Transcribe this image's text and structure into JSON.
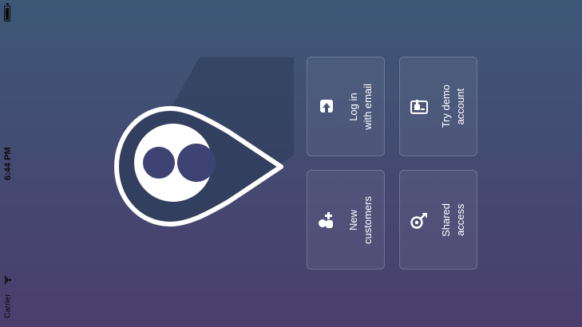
{
  "status_bar": {
    "time": "6:44 PM",
    "carrier": "Carrier",
    "battery_icon": "battery-icon",
    "wifi_icon": "wifi-icon"
  },
  "theme": {
    "gradient_top": "#3d5777",
    "gradient_bottom": "#4b3e6d",
    "ring_color": "#ffffff",
    "dot_color": "#3f4373"
  },
  "logo": {
    "icon": "location-pin-logo"
  },
  "tiles": [
    {
      "id": "login",
      "icon": "upload-icon",
      "label": "Log in\nwith email"
    },
    {
      "id": "demo",
      "icon": "package-icon",
      "label": "Try demo\naccount"
    },
    {
      "id": "new",
      "icon": "add-user-icon",
      "label": "New\ncustomers"
    },
    {
      "id": "shared",
      "icon": "key-icon",
      "label": "Shared\naccess"
    }
  ]
}
